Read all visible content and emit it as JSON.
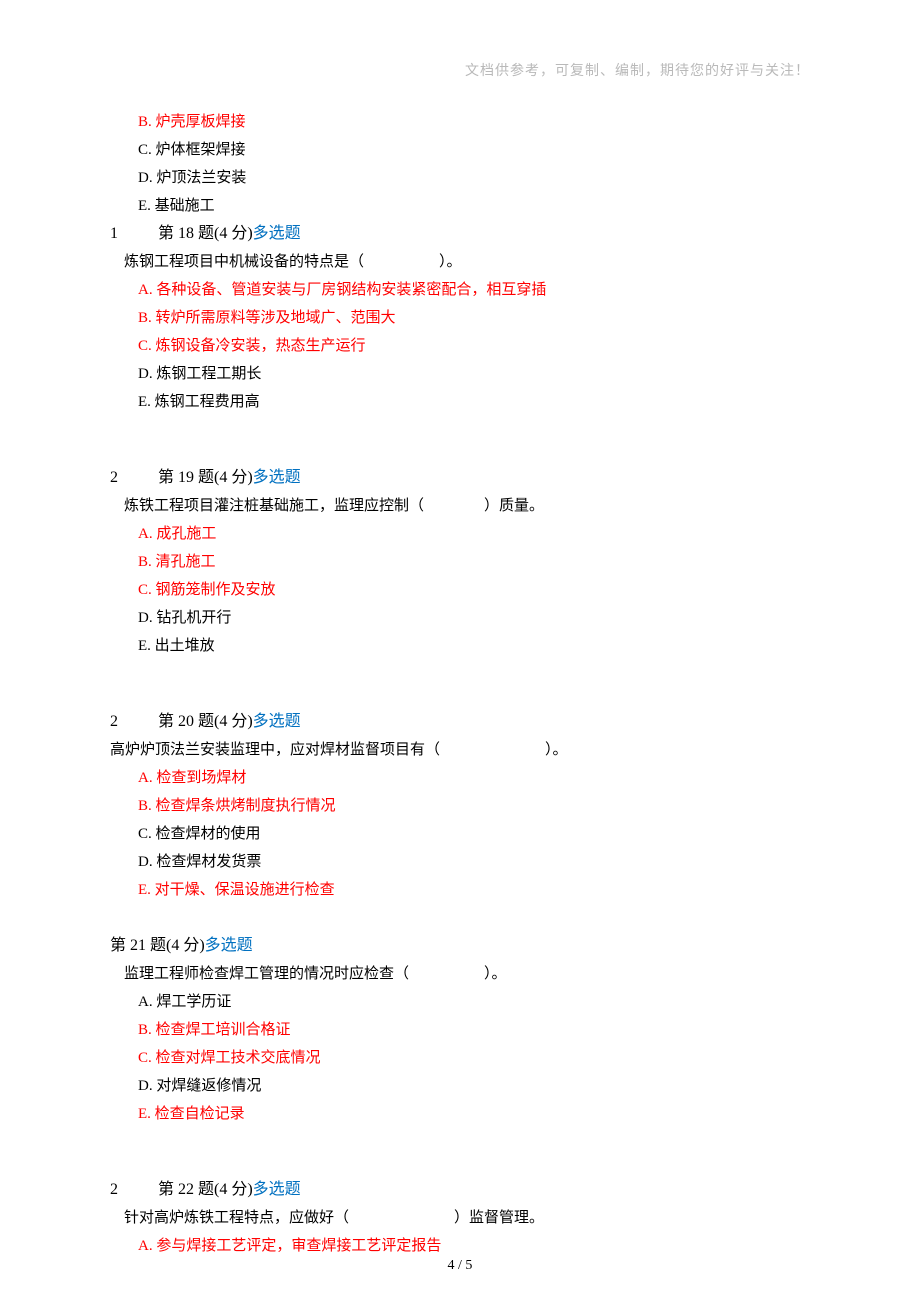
{
  "header_note": "文档供参考，可复制、编制，期待您的好评与关注！",
  "q_type_label": "多选题",
  "q17_tail": {
    "options": [
      {
        "k": "B.",
        "t": "炉壳厚板焊接",
        "hl": true
      },
      {
        "k": "C.",
        "t": "炉体框架焊接",
        "hl": false
      },
      {
        "k": "D.",
        "t": "炉顶法兰安装",
        "hl": false
      },
      {
        "k": "E.",
        "t": "基础施工",
        "hl": false
      }
    ]
  },
  "questions": [
    {
      "prefix": "1",
      "label_pre": "第 18 题(4 分)",
      "stem": "炼钢工程项目中机械设备的特点是（　　　　　）。",
      "stem_indent": true,
      "options": [
        {
          "k": "A.",
          "t": "各种设备、管道安装与厂房钢结构安装紧密配合，相互穿插",
          "hl": true
        },
        {
          "k": "B.",
          "t": "转炉所需原料等涉及地域广、范围大",
          "hl": true
        },
        {
          "k": "C.",
          "t": "炼钢设备冷安装，热态生产运行",
          "hl": true
        },
        {
          "k": "D.",
          "t": "炼钢工程工期长",
          "hl": false
        },
        {
          "k": "E.",
          "t": "炼钢工程费用高",
          "hl": false
        }
      ]
    },
    {
      "prefix": "2",
      "label_pre": "第 19 题(4 分)",
      "stem": "炼铁工程项目灌注桩基础施工，监理应控制（　　　　）质量。",
      "stem_indent": true,
      "options": [
        {
          "k": "A.",
          "t": "成孔施工",
          "hl": true
        },
        {
          "k": "B.",
          "t": "清孔施工",
          "hl": true
        },
        {
          "k": "C.",
          "t": "钢筋笼制作及安放",
          "hl": true
        },
        {
          "k": "D.",
          "t": "钻孔机开行",
          "hl": false
        },
        {
          "k": "E.",
          "t": "出土堆放",
          "hl": false
        }
      ]
    },
    {
      "prefix": "2",
      "label_pre": "第 20 题(4 分)",
      "stem": "高炉炉顶法兰安装监理中，应对焊材监督项目有（　　　　　　　）。",
      "stem_indent": false,
      "options": [
        {
          "k": "A.",
          "t": "检查到场焊材",
          "hl": true
        },
        {
          "k": "B.",
          "t": "检查焊条烘烤制度执行情况",
          "hl": true
        },
        {
          "k": "C.",
          "t": "检查焊材的使用",
          "hl": false
        },
        {
          "k": "D.",
          "t": "检查焊材发货票",
          "hl": false
        },
        {
          "k": "E.",
          "t": "对干燥、保温设施进行检查",
          "hl": true
        }
      ]
    },
    {
      "prefix": "",
      "label_pre": "第 21 题(4 分)",
      "stem": "监理工程师检查焊工管理的情况时应检查（　　　　　）。",
      "stem_indent": true,
      "tight": true,
      "options": [
        {
          "k": "A.",
          "t": "焊工学历证",
          "hl": false
        },
        {
          "k": "B.",
          "t": "检查焊工培训合格证",
          "hl": true
        },
        {
          "k": "C.",
          "t": "检查对焊工技术交底情况",
          "hl": true
        },
        {
          "k": "D.",
          "t": "对焊缝返修情况",
          "hl": false
        },
        {
          "k": "E.",
          "t": "检查自检记录",
          "hl": true
        }
      ]
    },
    {
      "prefix": "2",
      "label_pre": "第 22 题(4 分)",
      "stem": "针对高炉炼铁工程特点，应做好（　　　　　　　）监督管理。",
      "stem_indent": true,
      "options": [
        {
          "k": "A.",
          "t": "参与焊接工艺评定，审查焊接工艺评定报告",
          "hl": true
        }
      ]
    }
  ],
  "footer": "4 / 5"
}
